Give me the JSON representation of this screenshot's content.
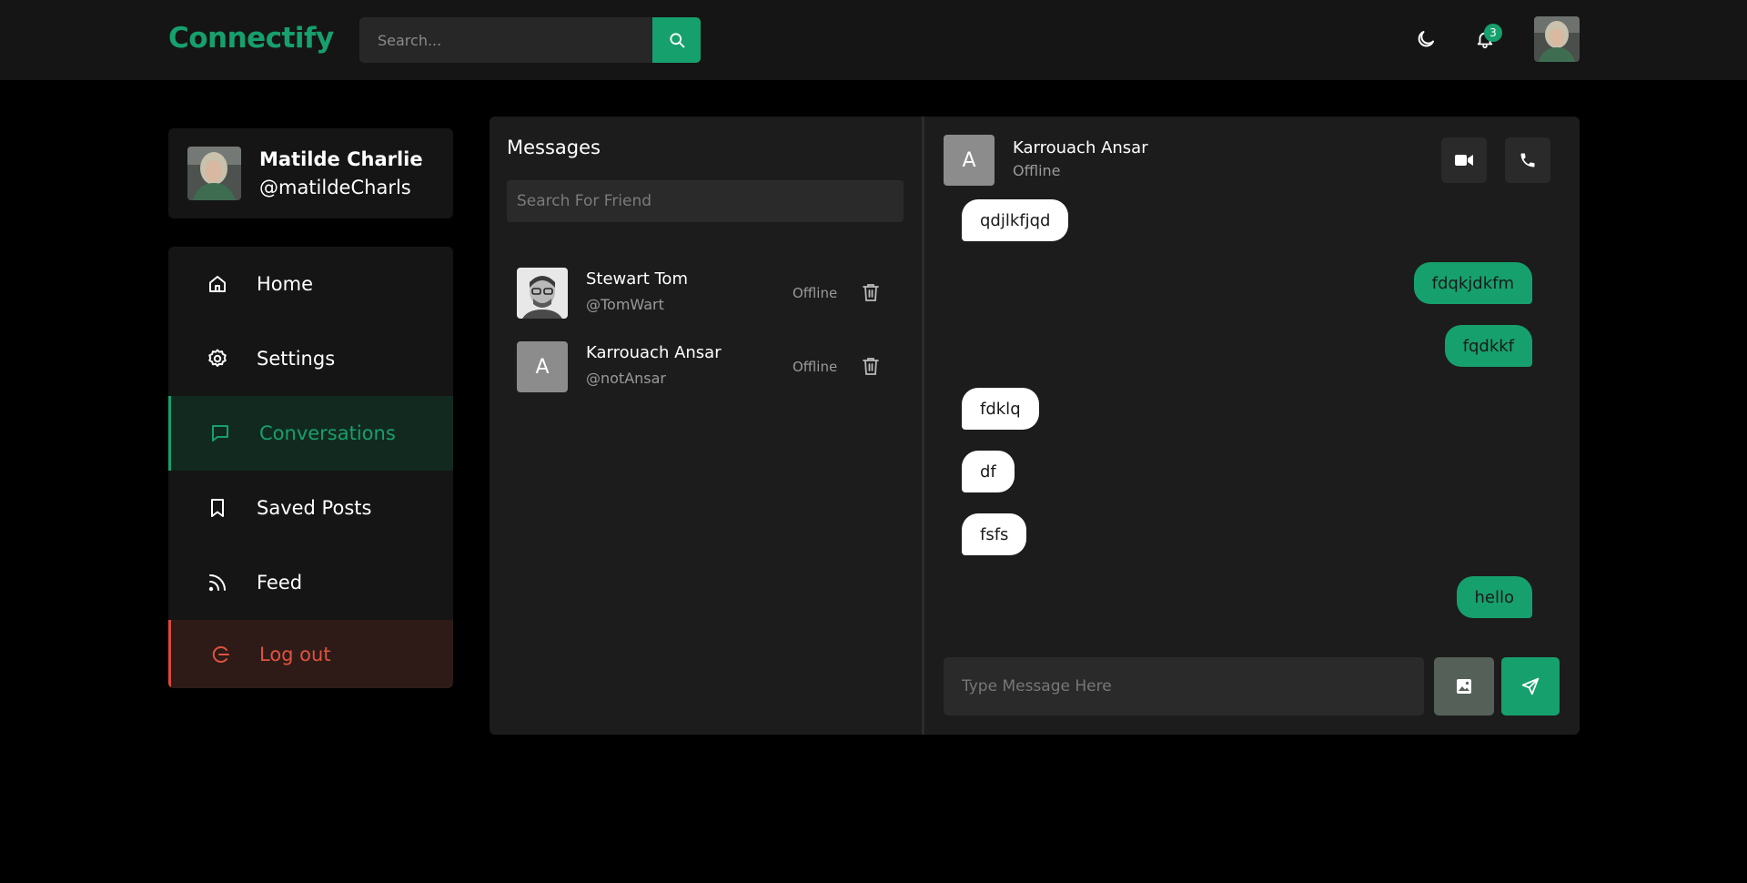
{
  "app": {
    "logo": "Connectify"
  },
  "header": {
    "search_placeholder": "Search...",
    "notification_count": "3",
    "icons": {
      "search": "search-icon",
      "theme": "moon-icon",
      "notifications": "bell-icon"
    }
  },
  "profile": {
    "name": "Matilde Charlie",
    "handle": "@matildeCharls"
  },
  "sidebar": {
    "items": [
      {
        "label": "Home",
        "icon": "home-icon"
      },
      {
        "label": "Settings",
        "icon": "gear-icon"
      },
      {
        "label": "Conversations",
        "icon": "chat-bubble-icon",
        "active": true
      },
      {
        "label": "Saved Posts",
        "icon": "bookmark-icon"
      },
      {
        "label": "Feed",
        "icon": "rss-icon"
      },
      {
        "label": "Log out",
        "icon": "logout-icon"
      }
    ]
  },
  "messages": {
    "title": "Messages",
    "search_placeholder": "Search For Friend",
    "friends": [
      {
        "name": "Stewart Tom",
        "handle": "@TomWart",
        "status": "Offline"
      },
      {
        "name": "Karrouach Ansar",
        "handle": "@notAnsar",
        "status": "Offline",
        "avatar_letter": "A"
      }
    ]
  },
  "chat": {
    "contact": {
      "name": "Karrouach Ansar",
      "status": "Offline",
      "avatar_letter": "A"
    },
    "messages": [
      {
        "text": "qdjlkfjqd",
        "direction": "in"
      },
      {
        "text": "fdqkjdkfm",
        "direction": "out"
      },
      {
        "text": "fqdkkf",
        "direction": "out"
      },
      {
        "text": "fdklq",
        "direction": "in"
      },
      {
        "text": "df",
        "direction": "in"
      },
      {
        "text": "fsfs",
        "direction": "in"
      },
      {
        "text": "hello",
        "direction": "out"
      }
    ],
    "input_placeholder": "Type Message Here"
  },
  "colors": {
    "accent": "#16a06d",
    "background": "#000000",
    "panel": "#1c1c1c",
    "logout": "#e0523f"
  }
}
